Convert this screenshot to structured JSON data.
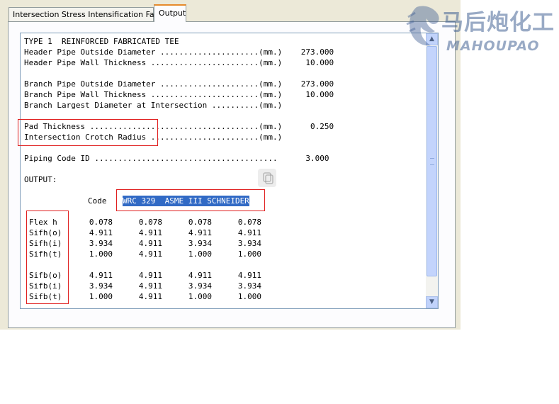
{
  "tabs": [
    {
      "label": "Intersection Stress Intensification Factors",
      "active": false
    },
    {
      "label": "Output",
      "active": true
    }
  ],
  "input_lines": [
    "TYPE 1  REINFORCED FABRICATED TEE",
    "Header Pipe Outside Diameter .....................(mm.)    273.000",
    "Header Pipe Wall Thickness .......................(mm.)     10.000",
    "",
    "Branch Pipe Outside Diameter .....................(mm.)    273.000",
    "Branch Pipe Wall Thickness .......................(mm.)     10.000",
    "Branch Largest Diameter at Intersection ..........(mm.)",
    "",
    "Pad Thickness ....................................(mm.)      0.250",
    "Intersection Crotch Radius .......................(mm.)",
    "",
    "Piping Code ID .......................................      3.000",
    "",
    "OUTPUT:"
  ],
  "output": {
    "code_label": "Code",
    "code_selected_text": "WRC 329  ASME III SCHNEIDER",
    "rows": [
      {
        "label": "Flex h",
        "values": [
          "0.078",
          "0.078",
          "0.078",
          "0.078"
        ]
      },
      {
        "label": "Sifh(o)",
        "values": [
          "4.911",
          "4.911",
          "4.911",
          "4.911"
        ]
      },
      {
        "label": "Sifh(i)",
        "values": [
          "3.934",
          "4.911",
          "3.934",
          "3.934"
        ]
      },
      {
        "label": "Sifh(t)",
        "values": [
          "1.000",
          "4.911",
          "1.000",
          "1.000"
        ]
      },
      {
        "label": "",
        "values": [
          "",
          "",
          "",
          ""
        ]
      },
      {
        "label": "Sifb(o)",
        "values": [
          "4.911",
          "4.911",
          "4.911",
          "4.911"
        ]
      },
      {
        "label": "Sifb(i)",
        "values": [
          "3.934",
          "4.911",
          "3.934",
          "3.934"
        ]
      },
      {
        "label": "Sifb(t)",
        "values": [
          "1.000",
          "4.911",
          "1.000",
          "1.000"
        ]
      }
    ]
  },
  "watermark": {
    "text_cn": "马后炮化工",
    "text_en": "MAHOUPAO"
  },
  "icons": {
    "scroll_up": "chevron-up-icon",
    "scroll_down": "chevron-down-icon",
    "watermark": "horse-logo-icon",
    "copy": "copy-icon"
  },
  "colors": {
    "selection": "#316ac5",
    "annotation_box": "#e02020",
    "active_tab_accent": "#e68b2c"
  }
}
